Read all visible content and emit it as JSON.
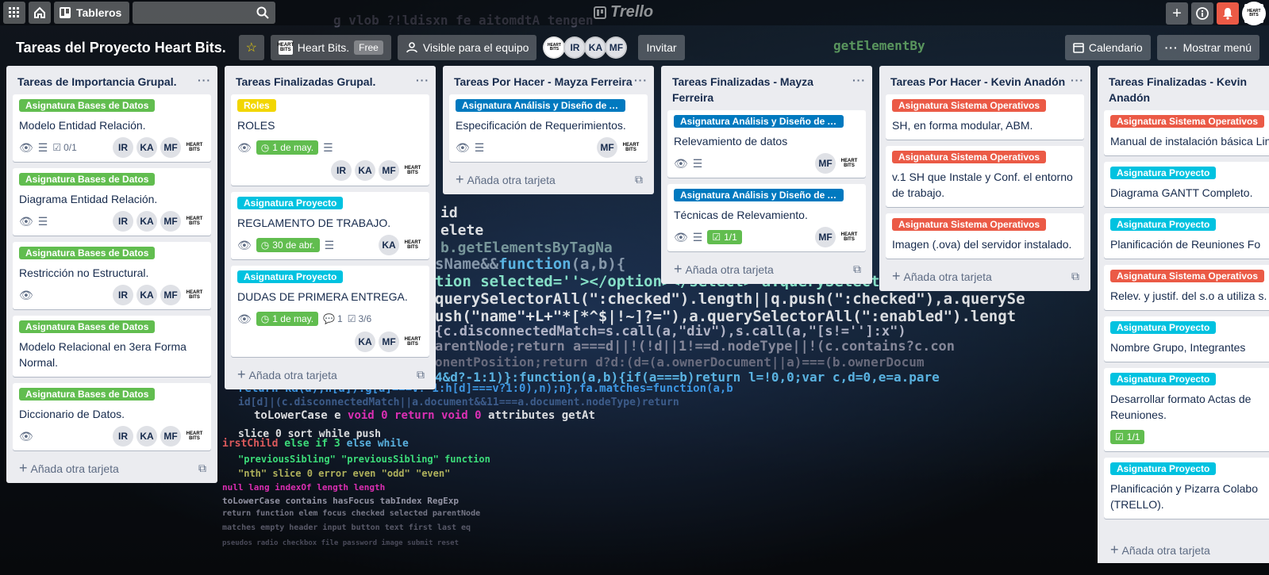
{
  "app": {
    "logo": "Trello",
    "boards_label": "Tableros"
  },
  "board": {
    "title": "Tareas del Proyecto Heart Bits.",
    "workspace": "Heart Bits.",
    "workspace_plan": "Free",
    "visibility": "Visible para el equipo",
    "members": [
      "IR",
      "KA",
      "MF"
    ],
    "invite": "Invitar",
    "calendar": "Calendario",
    "menu": "Mostrar menú",
    "add_card": "Añada otra tarjeta"
  },
  "colors": {
    "green": "#61bd4f",
    "yellow": "#f2d600",
    "blue": "#0079bf",
    "sky": "#00c2e0",
    "red": "#eb5a46"
  },
  "lists": [
    {
      "title": "Tareas de Importancia Grupal.",
      "cards": [
        {
          "label": "Asignatura Bases de Datos",
          "title": "Modelo Entidad Relación.",
          "checklist": "0/1"
        },
        {
          "label": "Asignatura Bases de Datos",
          "title": "Diagrama Entidad Relación."
        },
        {
          "label": "Asignatura Bases de Datos",
          "title": "Restricción no Estructural."
        },
        {
          "label": "Asignatura Bases de Datos",
          "title": "Modelo Relacional en 3era Forma Normal."
        },
        {
          "label": "Asignatura Bases de Datos",
          "title": "Diccionario de Datos."
        }
      ]
    },
    {
      "title": "Tareas Finalizadas Grupal.",
      "cards": [
        {
          "label": "Roles",
          "title": "ROLES",
          "due": "1 de may."
        },
        {
          "label": "Asignatura Proyecto",
          "title": "REGLAMENTO DE TRABAJO.",
          "due": "30 de abr."
        },
        {
          "label": "Asignatura Proyecto",
          "title": "DUDAS DE PRIMERA ENTREGA.",
          "due": "1 de may.",
          "comments": "1",
          "checklist": "3/6"
        }
      ]
    },
    {
      "title": "Tareas Por Hacer - Mayza Ferreira",
      "cards": [
        {
          "label": "Asignatura Análisis y Diseño de Ap...",
          "title": "Especificación de Requerimientos."
        }
      ]
    },
    {
      "title": "Tareas Finalizadas - Mayza Ferreira",
      "cards": [
        {
          "label": "Asignatura Análisis y Diseño de Ap...",
          "title": "Relevamiento de datos"
        },
        {
          "label": "Asignatura Análisis y Diseño de Ap...",
          "title": "Técnicas de Relevamiento.",
          "checklist": "1/1"
        }
      ]
    },
    {
      "title": "Tareas Por Hacer - Kevin Anadón",
      "cards": [
        {
          "label": "Asignatura Sistema Operativos",
          "title": "SH, en forma modular, ABM."
        },
        {
          "label": "Asignatura Sistema Operativos",
          "title": "v.1 SH que Instale y Conf. el entorno de trabajo."
        },
        {
          "label": "Asignatura Sistema Operativos",
          "title": "Imagen (.ova) del servidor instalado."
        }
      ]
    },
    {
      "title": "Tareas Finalizadas - Kevin Anadón",
      "cards": [
        {
          "label": "Asignatura Sistema Operativos",
          "title": "Manual de instalación básica Linux."
        },
        {
          "label": "Asignatura Proyecto",
          "title": "Diagrama GANTT Completo."
        },
        {
          "label": "Asignatura Proyecto",
          "title": "Planificación de Reuniones Fo"
        },
        {
          "label": "Asignatura Sistema Operativos",
          "title": "Relev. y justif. del s.o a utiliza s. y t."
        },
        {
          "label": "Asignatura Proyecto",
          "title": "Nombre Grupo, Integrantes"
        },
        {
          "label": "Asignatura Proyecto",
          "title": "Desarrollar formato Actas de Reuniones.",
          "checklist": "1/1"
        },
        {
          "label": "Asignatura Proyecto",
          "title": "Planificación y Pizarra Colabo (TRELLO)."
        }
      ]
    }
  ]
}
